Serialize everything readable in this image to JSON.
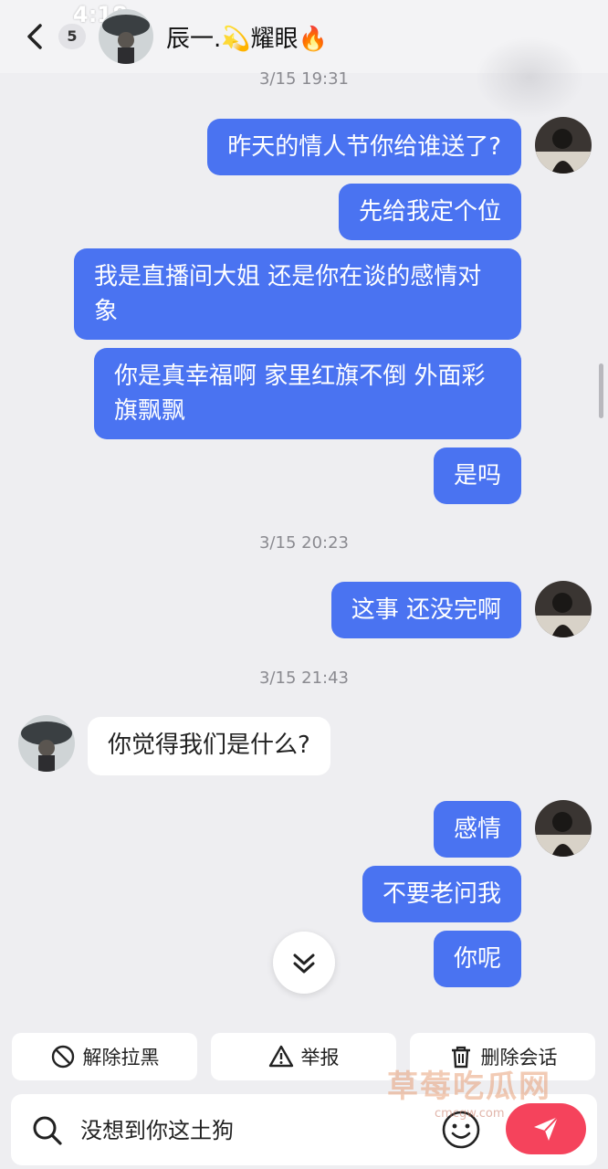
{
  "status": {
    "time": "4:18"
  },
  "header": {
    "unread_count": "5",
    "contact_name": "辰一.💫耀眼🔥"
  },
  "timestamps": [
    "3/15 19:31",
    "3/15 20:23",
    "3/15 21:43"
  ],
  "messages": [
    {
      "dir": "out",
      "text": "昨天的情人节你给谁送了?"
    },
    {
      "dir": "out",
      "text": "先给我定个位"
    },
    {
      "dir": "out",
      "text": "我是直播间大姐 还是你在谈的感情对象"
    },
    {
      "dir": "out",
      "text": "你是真幸福啊 家里红旗不倒 外面彩旗飘飘"
    },
    {
      "dir": "out",
      "text": "是吗"
    },
    {
      "dir": "out",
      "text": "这事 还没完啊"
    },
    {
      "dir": "in",
      "text": "你觉得我们是什么?"
    },
    {
      "dir": "out",
      "text": "感情"
    },
    {
      "dir": "out",
      "text": "不要老问我"
    },
    {
      "dir": "out",
      "text": "你呢"
    }
  ],
  "actions": {
    "unblock": "解除拉黑",
    "report": "举报",
    "delete_chat": "删除会话"
  },
  "input": {
    "value": "没想到你这土狗"
  },
  "watermark": {
    "text": "草莓吃瓜网",
    "sub": "cmcgw.com"
  },
  "colors": {
    "outgoing_bubble": "#4a73f1",
    "send_button": "#f5435c",
    "background": "#eeeef1"
  }
}
